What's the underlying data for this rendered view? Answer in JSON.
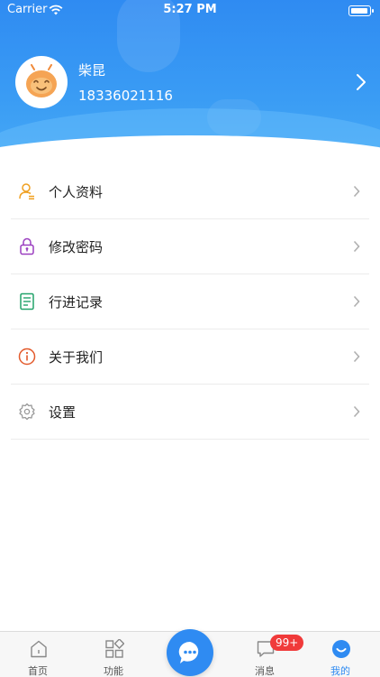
{
  "status_bar": {
    "carrier": "Carrier",
    "time": "5:27 PM"
  },
  "profile": {
    "name": "柴昆",
    "phone": "18336021116"
  },
  "menu": [
    {
      "label": "个人资料",
      "icon": "user-icon",
      "color": "#f0a020"
    },
    {
      "label": "修改密码",
      "icon": "lock-icon",
      "color": "#9b3fc0"
    },
    {
      "label": "行进记录",
      "icon": "record-icon",
      "color": "#22a36a"
    },
    {
      "label": "关于我们",
      "icon": "info-icon",
      "color": "#e35a2c"
    },
    {
      "label": "设置",
      "icon": "settings-icon",
      "color": "#999999"
    }
  ],
  "tabbar": {
    "home_label": "首页",
    "features_label": "功能",
    "messages_label": "消息",
    "mine_label": "我的",
    "messages_badge": "99+"
  },
  "colors": {
    "accent": "#2f8bf2",
    "badge": "#f03a3a"
  }
}
